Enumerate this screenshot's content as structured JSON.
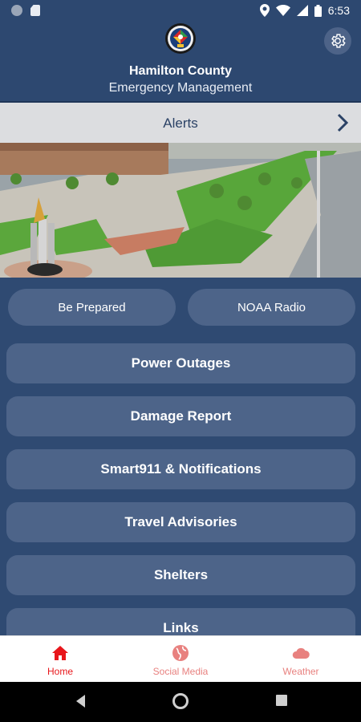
{
  "status_bar": {
    "time": "6:53"
  },
  "header": {
    "title": "Hamilton County",
    "subtitle": "Emergency Management"
  },
  "alerts": {
    "label": "Alerts"
  },
  "buttons": {
    "be_prepared": "Be Prepared",
    "noaa_radio": "NOAA Radio",
    "power_outages": "Power Outages",
    "damage_report": "Damage Report",
    "smart911": "Smart911 & Notifications",
    "travel_advisories": "Travel Advisories",
    "shelters": "Shelters",
    "links": "Links"
  },
  "bottom_nav": {
    "items": [
      {
        "label": "Home",
        "icon": "home-icon",
        "active": true
      },
      {
        "label": "Social Media",
        "icon": "globe-icon",
        "active": false
      },
      {
        "label": "Weather",
        "icon": "cloud-icon",
        "active": false
      }
    ]
  },
  "colors": {
    "header_bg": "#2d4870",
    "content_bg": "#2f4a72",
    "button_bg": "#4d6489",
    "active_red": "#e8161b",
    "inactive_nav": "#e8817f"
  }
}
